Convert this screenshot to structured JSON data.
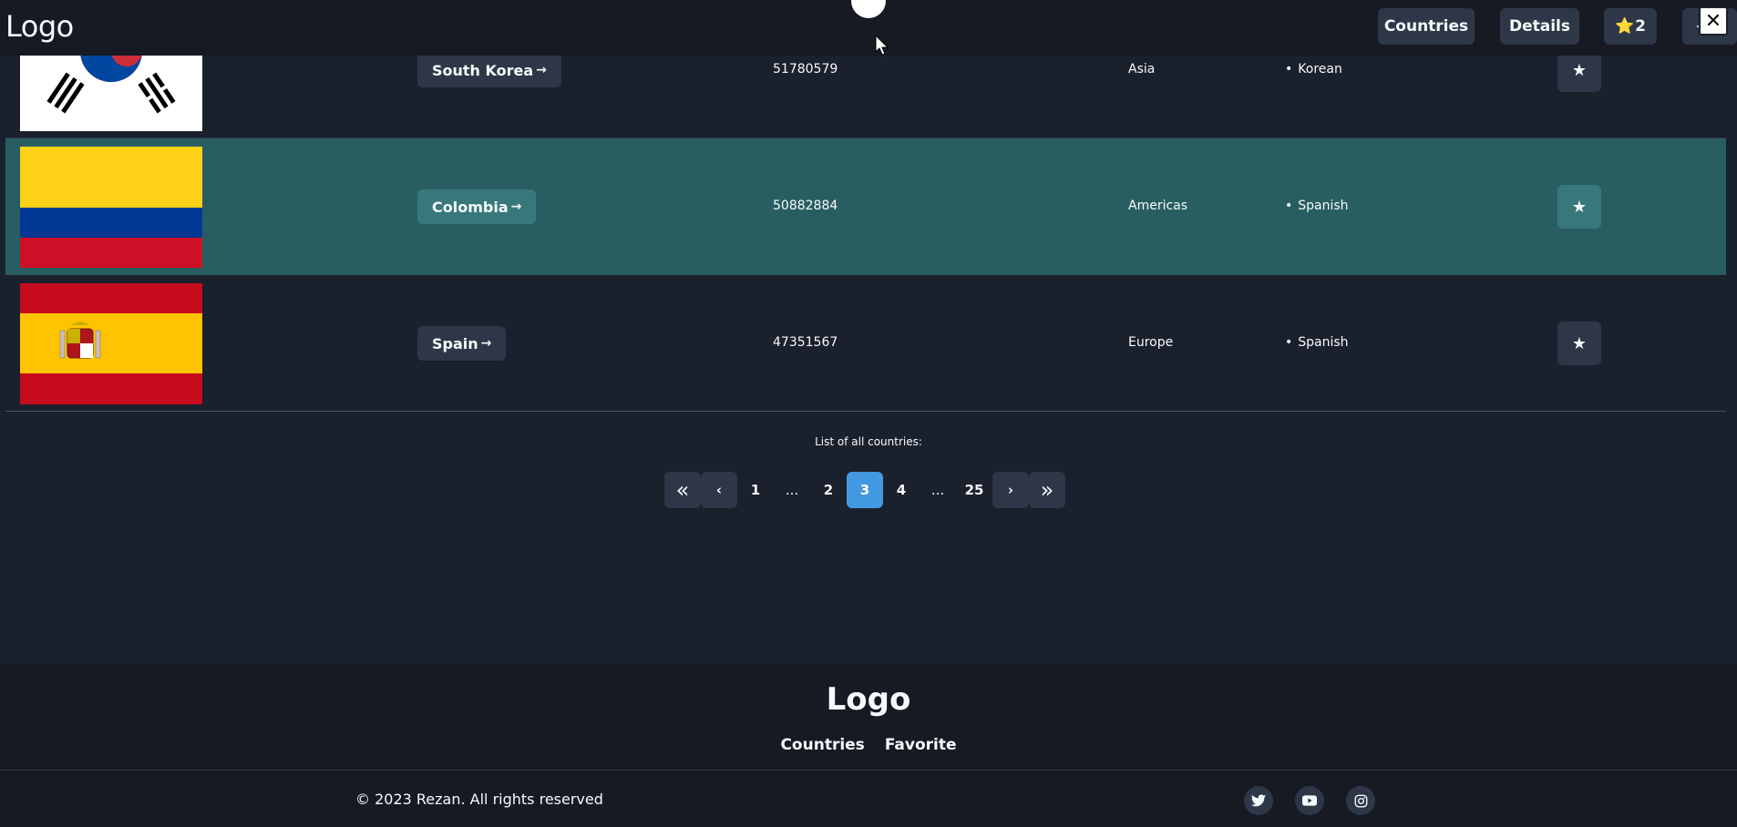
{
  "header": {
    "logo": "Logo",
    "nav": {
      "countries": "Countries",
      "details": "Details",
      "favorites_count": "2",
      "favorites_star": "⭐"
    },
    "close": "✕"
  },
  "rows": [
    {
      "country": "South Korea",
      "population": "51780579",
      "region": "Asia",
      "language": "Korean",
      "flag_icon": "south-korea-flag",
      "highlighted": false
    },
    {
      "country": "Colombia",
      "population": "50882884",
      "region": "Americas",
      "language": "Spanish",
      "flag_icon": "colombia-flag",
      "highlighted": true
    },
    {
      "country": "Spain",
      "population": "47351567",
      "region": "Europe",
      "language": "Spanish",
      "flag_icon": "spain-flag",
      "highlighted": false
    }
  ],
  "row_labels": {
    "arrow": "→",
    "bullet": "•",
    "star": "★"
  },
  "table_caption": "List of all countries:",
  "pagination": {
    "first": "«",
    "prev": "‹",
    "pages": [
      "1",
      "...",
      "2",
      "3",
      "4",
      "...",
      "25"
    ],
    "current": "3",
    "next": "›",
    "last": "»"
  },
  "footer": {
    "logo": "Logo",
    "links": [
      "Countries",
      "Favorite"
    ],
    "copyright": "© 2023 Rezan. All rights reserved",
    "social_icons": [
      "twitter-icon",
      "youtube-icon",
      "instagram-icon"
    ]
  },
  "colors": {
    "background": "#1a202c",
    "header": "#171923",
    "highlight_row": "#285e61",
    "active_page": "#4299e1",
    "button": "#2d3748"
  }
}
